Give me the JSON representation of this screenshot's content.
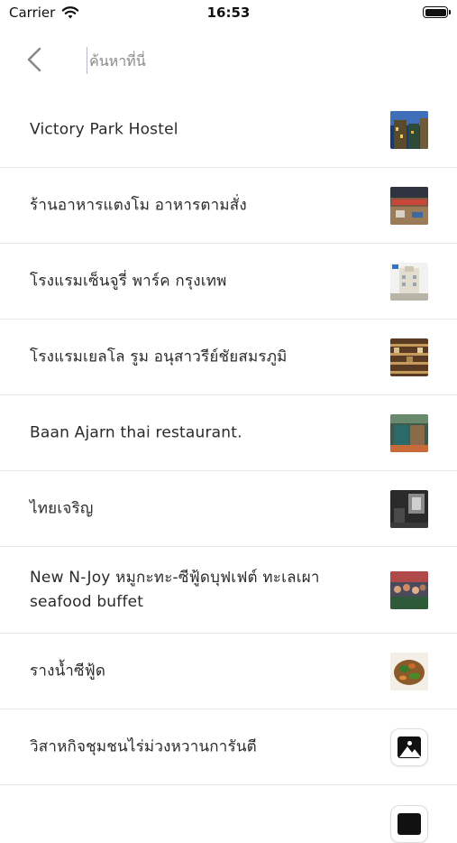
{
  "status_bar": {
    "carrier": "Carrier",
    "time": "16:53"
  },
  "search": {
    "placeholder": "ค้นหาที่นี่",
    "value": ""
  },
  "results": [
    {
      "name": "Victory Park Hostel",
      "thumbnail": "photo-hostel-exterior"
    },
    {
      "name": "ร้านอาหารแตงโม อาหารตามสั่ง",
      "thumbnail": "photo-restaurant-interior"
    },
    {
      "name": "โรงแรมเซ็นจูรี่ พาร์ค กรุงเทพ",
      "thumbnail": "photo-hotel-building"
    },
    {
      "name": "โรงแรมเยลโล รูม อนุสาวรีย์ชัยสมรภูมิ",
      "thumbnail": "photo-shelves"
    },
    {
      "name": "Baan Ajarn thai restaurant.",
      "thumbnail": "photo-shopfront"
    },
    {
      "name": "ไทยเจริญ",
      "thumbnail": "photo-dark-interior"
    },
    {
      "name": "New N-Joy หมูกะทะ-ซีฟู้ดบุฟเฟต์ ทะเลเผา seafood buffet",
      "thumbnail": "photo-crowd-buffet"
    },
    {
      "name": "รางน้ำซีฟู้ด",
      "thumbnail": "photo-seafood-dish"
    },
    {
      "name": "วิสาหกิจชุมชนไร่ม่วงหวานการันตี",
      "thumbnail": "placeholder-image-icon"
    }
  ]
}
